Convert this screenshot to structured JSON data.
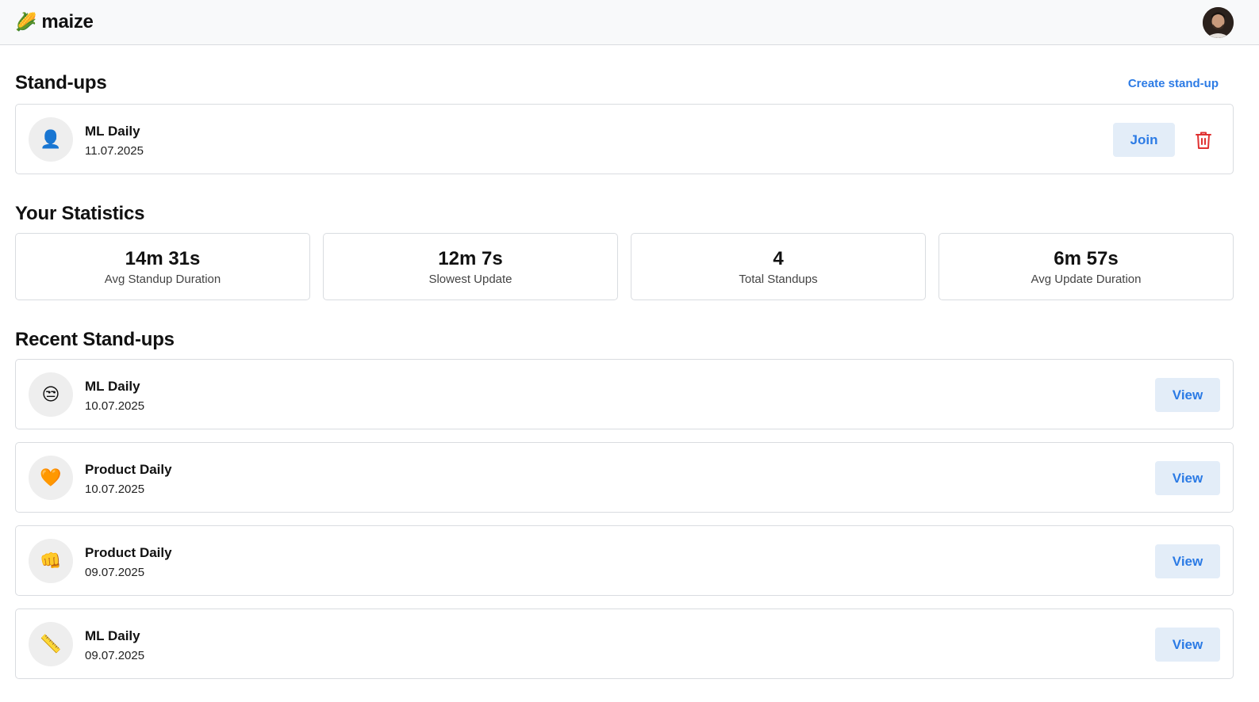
{
  "app": {
    "name": "maize",
    "logo_emoji": "🌽"
  },
  "standups": {
    "title": "Stand-ups",
    "create_label": "Create stand-up",
    "active": [
      {
        "name": "ML Daily",
        "date": "11.07.2025",
        "emoji": "👤",
        "join_label": "Join"
      }
    ]
  },
  "stats": {
    "title": "Your Statistics",
    "items": [
      {
        "value": "14m 31s",
        "label": "Avg Standup Duration"
      },
      {
        "value": "12m 7s",
        "label": "Slowest Update"
      },
      {
        "value": "4",
        "label": "Total Standups"
      },
      {
        "value": "6m 57s",
        "label": "Avg Update Duration"
      }
    ]
  },
  "recent": {
    "title": "Recent Stand-ups",
    "view_label": "View",
    "items": [
      {
        "name": "ML Daily",
        "date": "10.07.2025",
        "emoji": "😒"
      },
      {
        "name": "Product Daily",
        "date": "10.07.2025",
        "emoji": "🧡"
      },
      {
        "name": "Product Daily",
        "date": "09.07.2025",
        "emoji": "👊"
      },
      {
        "name": "ML Daily",
        "date": "09.07.2025",
        "emoji": "📏"
      }
    ]
  },
  "colors": {
    "accent": "#2c7be5",
    "button_bg": "#e3edf8",
    "danger": "#e03131",
    "border": "#d9dce0"
  },
  "icons": {
    "delete": "trash-icon",
    "avatar": "user-avatar"
  }
}
